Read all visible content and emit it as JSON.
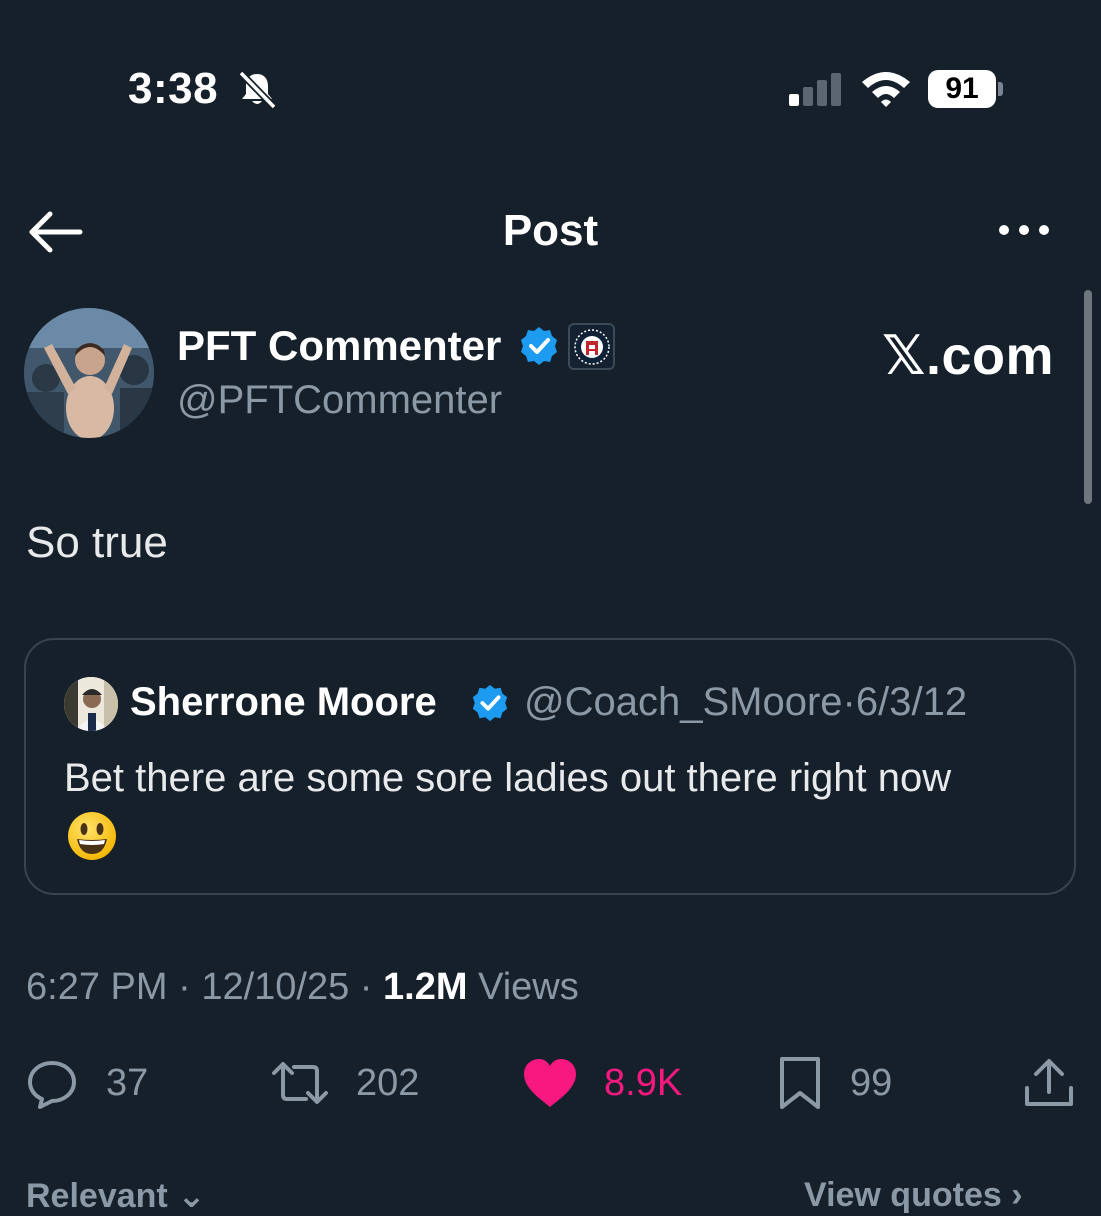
{
  "status_bar": {
    "time": "3:38",
    "battery": "91"
  },
  "header": {
    "title": "Post"
  },
  "author": {
    "name": "PFT Commenter",
    "handle": "@PFTCommenter"
  },
  "watermark": "𝕏.com",
  "post": {
    "text": "So true"
  },
  "quote": {
    "name": "Sherrone Moore",
    "handle": "@Coach_SMoore",
    "date": "6/3/12",
    "separator": "·",
    "text": "Bet there are some sore ladies out there right now"
  },
  "meta": {
    "time": "6:27 PM",
    "date": "12/10/25",
    "views_count": "1.2M",
    "views_label": "Views",
    "separator": "·"
  },
  "actions": {
    "replies": "37",
    "reposts": "202",
    "likes": "8.9K",
    "bookmarks": "99"
  },
  "footer": {
    "sort_label": "Relevant",
    "quotes_label": "View quotes"
  },
  "colors": {
    "background": "#15202b",
    "like": "#f91880",
    "verified": "#1d9bf0",
    "muted": "#8b98a5"
  }
}
